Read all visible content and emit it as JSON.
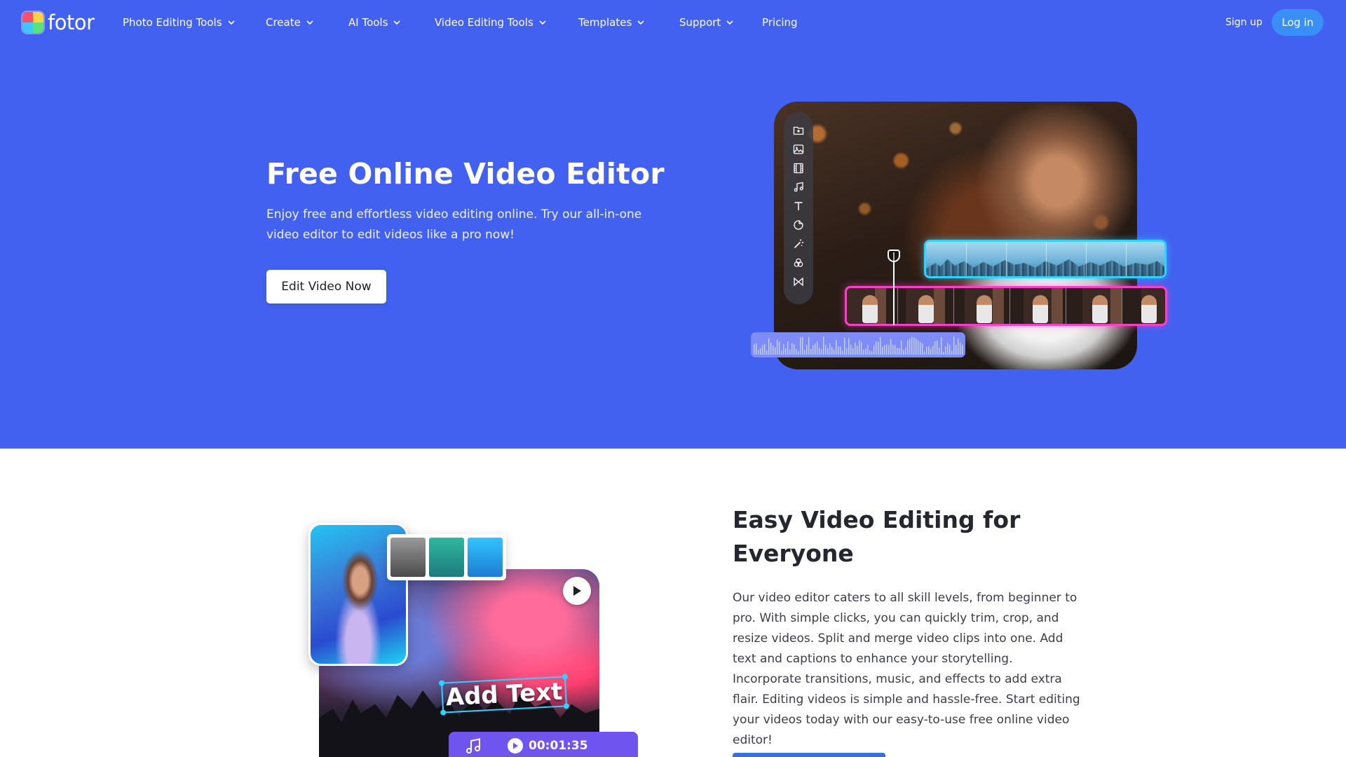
{
  "brand": {
    "name": "fotor"
  },
  "nav": {
    "items": [
      {
        "label": "Photo Editing Tools",
        "dropdown": true
      },
      {
        "label": "Create",
        "dropdown": true
      },
      {
        "label": "AI Tools",
        "dropdown": true
      },
      {
        "label": "Video Editing Tools",
        "dropdown": true
      },
      {
        "label": "Templates",
        "dropdown": true
      },
      {
        "label": "Support",
        "dropdown": true
      },
      {
        "label": "Pricing",
        "dropdown": false
      }
    ],
    "signup_label": "Sign up",
    "login_label": "Log in"
  },
  "hero": {
    "title": "Free Online Video Editor",
    "description": "Enjoy free and effortless video editing online. Try our all-in-one video editor to edit videos like a pro now!",
    "cta_label": "Edit Video Now",
    "toolbar_icons": [
      "upload-folder-icon",
      "image-icon",
      "film-icon",
      "music-note-icon",
      "text-icon",
      "sticker-icon",
      "magic-wand-icon",
      "filter-icon",
      "transition-icon"
    ]
  },
  "feature": {
    "title": "Easy Video Editing for Everyone",
    "description": "Our video editor caters to all skill levels, from beginner to pro. With simple clicks, you can quickly trim, crop, and resize videos. Split and merge video clips into one. Add text and captions to enhance your storytelling. Incorporate transitions, music, and effects to add extra flair. Editing videos is simple and hassle-free. Start editing your videos today with our easy-to-use free online video editor!",
    "illustration": {
      "overlay_text": "Add Text",
      "timecode": "00:01:35"
    }
  },
  "colors": {
    "hero_bg": "#4361f0",
    "login_bg": "#3a8ff6",
    "track_cyan": "#2ed3ff",
    "track_pink": "#ff3ec8",
    "timeline_bar": "#6f54f0",
    "cta_blue": "#2f6ff5"
  }
}
